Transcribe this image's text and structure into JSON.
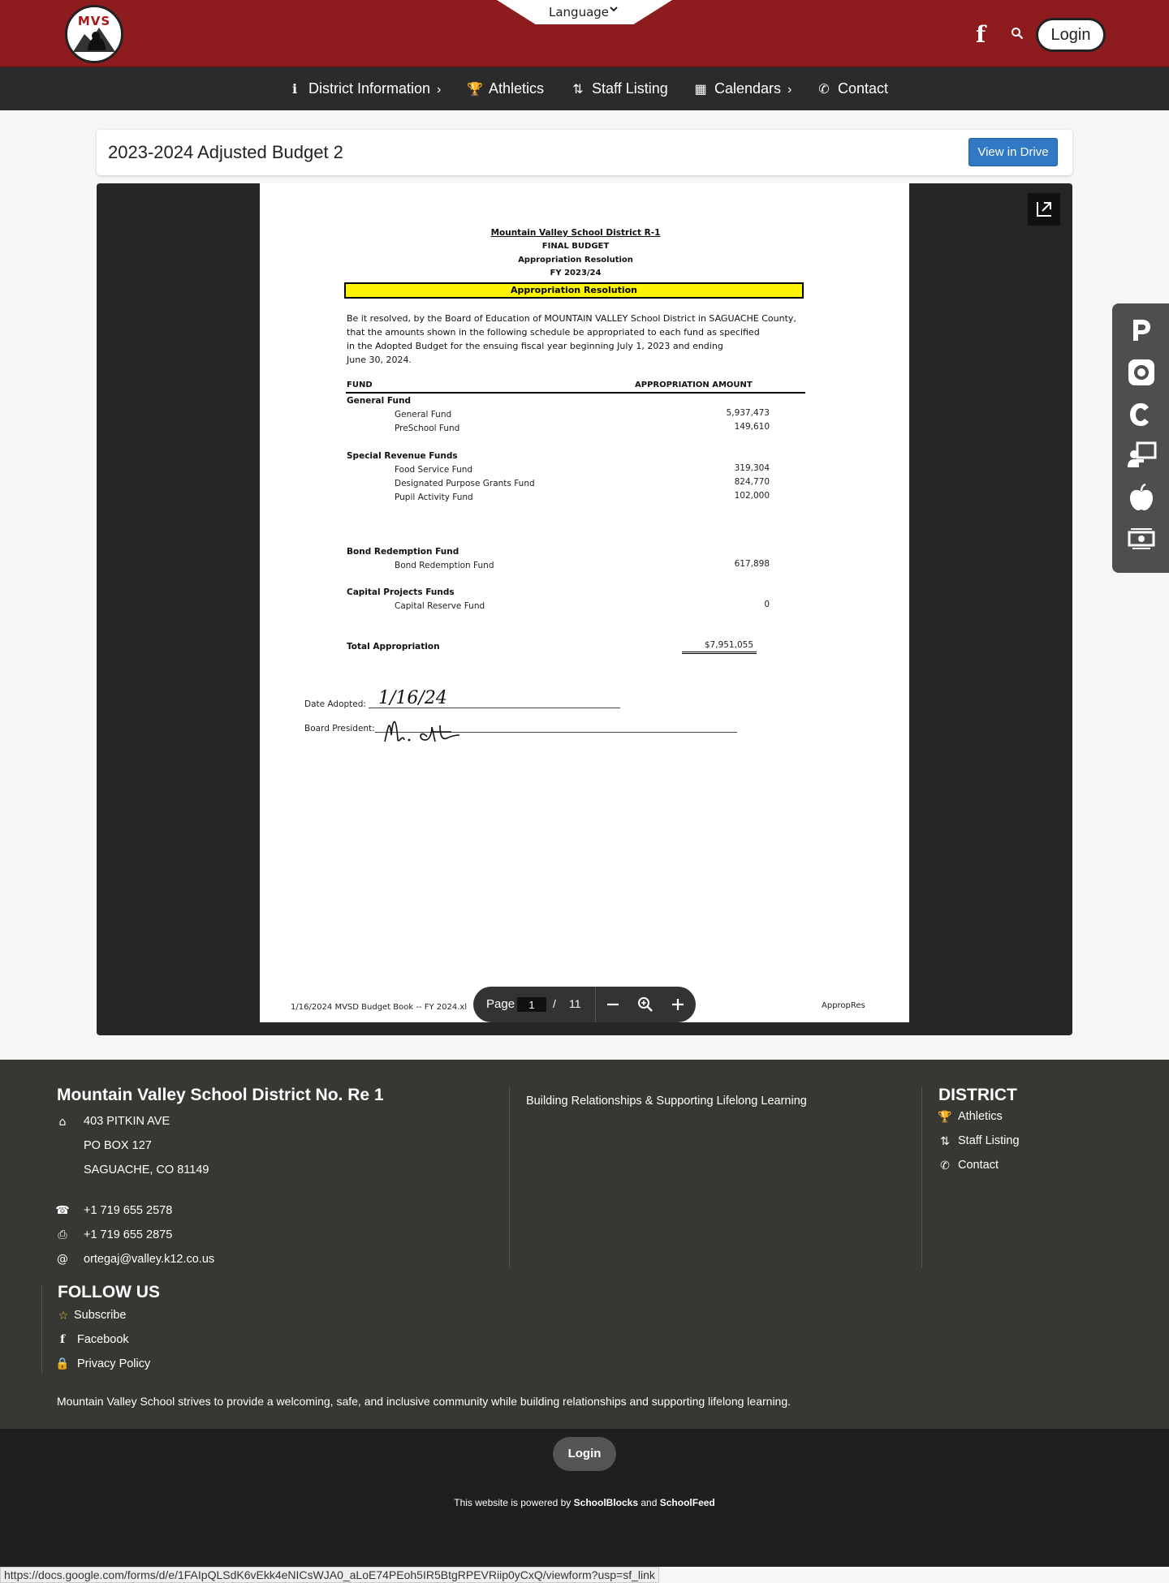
{
  "header": {
    "language_label": "Language",
    "login_label": "Login",
    "logo_text": "MVS"
  },
  "nav": {
    "items": [
      {
        "label": "District Information"
      },
      {
        "label": "Athletics"
      },
      {
        "label": "Staff Listing"
      },
      {
        "label": "Calendars"
      },
      {
        "label": "Contact"
      }
    ]
  },
  "page": {
    "title": "2023-2024 Adjusted Budget 2",
    "view_in_drive": "View in Drive"
  },
  "document": {
    "heading": "Mountain Valley School District R-1",
    "line2": "FINAL BUDGET",
    "line3": "Appropriation Resolution",
    "line4": "FY 2023/24",
    "banner": "Appropriation Resolution",
    "para": [
      "Be it resolved, by the Board of Education of MOUNTAIN VALLEY School District in SAGUACHE County,",
      "that the amounts shown in the following schedule be appropriated to each fund as specified",
      "in the Adopted Budget for the ensuing fiscal year beginning July 1, 2023 and ending",
      "June 30, 2024."
    ],
    "col_fund": "FUND",
    "col_amount": "APPROPRIATION AMOUNT",
    "groups": {
      "general": "General Fund",
      "special": "Special Revenue Funds",
      "bond": "Bond Redemption Fund",
      "capital": "Capital Projects Funds"
    },
    "funds": [
      {
        "name": "General Fund",
        "amount": "5,937,473"
      },
      {
        "name": "PreSchool Fund",
        "amount": "149,610"
      },
      {
        "name": "Food Service Fund",
        "amount": "319,304"
      },
      {
        "name": "Designated Purpose Grants Fund",
        "amount": "824,770"
      },
      {
        "name": "Pupil Activity Fund",
        "amount": "102,000"
      },
      {
        "name": "Bond Redemption Fund",
        "amount": "617,898"
      },
      {
        "name": "Capital Reserve Fund",
        "amount": "0"
      }
    ],
    "total_label": "Total Appropriation",
    "total_amount": "$7,951,055",
    "date_label": "Date Adopted:",
    "president_label": "Board President:",
    "date_signed": "1/16/24",
    "footer_left": "1/16/2024 MVSD Budget Book -- FY 2024.xl",
    "footer_right": "AppropRes"
  },
  "viewer": {
    "page_label": "Page",
    "current_page": "1",
    "slash": "/",
    "total_pages": "11"
  },
  "footer": {
    "district_name": "Mountain Valley School District No. Re 1",
    "address1": "403 PITKIN AVE",
    "address2": "PO BOX 127",
    "address3": "SAGUACHE, CO 81149",
    "phone": "+1 719 655 2578",
    "fax": "+1 719 655 2875",
    "email": "ortegaj@valley.k12.co.us",
    "tagline": "Building Relationships & Supporting Lifelong Learning",
    "district_heading": "DISTRICT",
    "district_links": [
      "Athletics",
      "Staff Listing",
      "Contact"
    ],
    "follow_heading": "FOLLOW US",
    "follow_links": [
      "Subscribe",
      "Facebook",
      "Privacy Policy"
    ],
    "mission": "Mountain Valley School strives to provide a welcoming, safe, and inclusive community while building relationships and supporting lifelong learning."
  },
  "bottom": {
    "login_label": "Login",
    "powered_prefix": "This website is powered by",
    "powered_a": "SchoolBlocks",
    "powered_and": "and",
    "powered_b": "SchoolFeed"
  },
  "status_url": "https://docs.google.com/forms/d/e/1FAIpQLSdK6vEkk4eNICsWJA0_aLoE74PEoh5IR5BtgRPEVRiip0yCxQ/viewform?usp=sf_link",
  "colors": {
    "brand_red": "#8e1b1d",
    "nav_dark": "#2b2b2b",
    "button_blue": "#3179c4",
    "footer_bg": "#373733",
    "highlight_yellow": "#fcf400"
  },
  "icons": {
    "rail": [
      "powerschool-icon",
      "lifebuoy-icon",
      "c-logo-icon",
      "teacher-icon",
      "apple-icon",
      "money-icon"
    ]
  }
}
